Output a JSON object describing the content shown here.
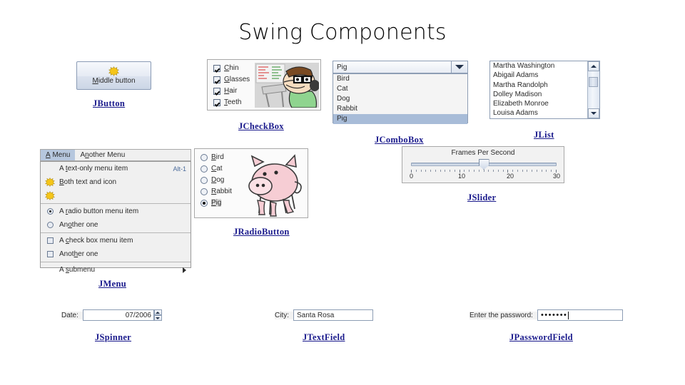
{
  "slide": {
    "title": "Swing Components"
  },
  "jbutton": {
    "caption": "JButton",
    "label_pre": "M",
    "label_mn": "i",
    "label_post": "ddle button",
    "label_full": "Middle button",
    "icon": "starburst-icon"
  },
  "jcheckbox": {
    "caption": "JCheckBox",
    "items": [
      {
        "label": "Chin",
        "mnemonic": "C",
        "checked": true
      },
      {
        "label": "Glasses",
        "mnemonic": "G",
        "checked": true
      },
      {
        "label": "Hair",
        "mnemonic": "H",
        "checked": true
      },
      {
        "label": "Teeth",
        "mnemonic": "T",
        "checked": true
      }
    ],
    "image_alt": "cartoon-man-at-desk"
  },
  "jcombobox": {
    "caption": "JComboBox",
    "selected": "Pig",
    "options": [
      "Bird",
      "Cat",
      "Dog",
      "Rabbit",
      "Pig"
    ],
    "arrow_icon": "chevron-down-icon"
  },
  "jlist": {
    "caption": "JList",
    "items": [
      "Martha Washington",
      "Abigail Adams",
      "Martha Randolph",
      "Dolley Madison",
      "Elizabeth Monroe",
      "Louisa Adams"
    ],
    "scrollbar": {
      "up_icon": "scroll-up-icon",
      "down_icon": "scroll-down-icon"
    }
  },
  "jmenu": {
    "caption": "JMenu",
    "menubar": [
      {
        "label": "A Menu",
        "mnemonic": "A",
        "active": true
      },
      {
        "label": "Another Menu",
        "mnemonic": "n",
        "active": false
      }
    ],
    "items": [
      {
        "type": "text",
        "label": "A text-only menu item",
        "mnemonic": "t",
        "accel": "Alt-1"
      },
      {
        "type": "icon-text",
        "label": "Both text and icon",
        "mnemonic": "B",
        "icon": "starburst-icon"
      },
      {
        "type": "icon-only",
        "label": "",
        "icon": "starburst-icon"
      },
      {
        "type": "separator"
      },
      {
        "type": "radio",
        "label": "A radio button menu item",
        "mnemonic": "r",
        "selected": true
      },
      {
        "type": "radio",
        "label": "Another one",
        "mnemonic": "o",
        "selected": false
      },
      {
        "type": "separator"
      },
      {
        "type": "check",
        "label": "A check box menu item",
        "mnemonic": "c",
        "selected": false
      },
      {
        "type": "check",
        "label": "Another one",
        "mnemonic": "h",
        "selected": false
      },
      {
        "type": "separator"
      },
      {
        "type": "submenu",
        "label": "A submenu",
        "mnemonic": "s",
        "arrow": "submenu-arrow-icon"
      }
    ]
  },
  "jradiobutton": {
    "caption": "JRadioButton",
    "items": [
      {
        "label": "Bird",
        "mnemonic": "B",
        "selected": false
      },
      {
        "label": "Cat",
        "mnemonic": "C",
        "selected": false
      },
      {
        "label": "Dog",
        "mnemonic": "D",
        "selected": false
      },
      {
        "label": "Rabbit",
        "mnemonic": "R",
        "selected": false
      },
      {
        "label": "Pig",
        "mnemonic": "P",
        "selected": true
      }
    ],
    "image_alt": "pig-drawing"
  },
  "jslider": {
    "caption": "JSlider",
    "title": "Frames Per Second",
    "min": 0,
    "max": 30,
    "value": 15,
    "tick_labels": [
      "0",
      "10",
      "20",
      "30"
    ]
  },
  "jspinner": {
    "caption": "JSpinner",
    "label": "Date:",
    "value": "07/2006",
    "up_icon": "spinner-up-icon",
    "down_icon": "spinner-down-icon"
  },
  "jtextfield": {
    "caption": "JTextField",
    "label": "City:",
    "value": "Santa Rosa"
  },
  "jpasswordfield": {
    "caption": "JPasswordField",
    "label": "Enter the password:",
    "value": "•••••••"
  },
  "colors": {
    "caption": "#1a1a8c",
    "selection": "#a8bcd8",
    "menubar_active": "#b6c7de",
    "background": "#ffffff"
  }
}
